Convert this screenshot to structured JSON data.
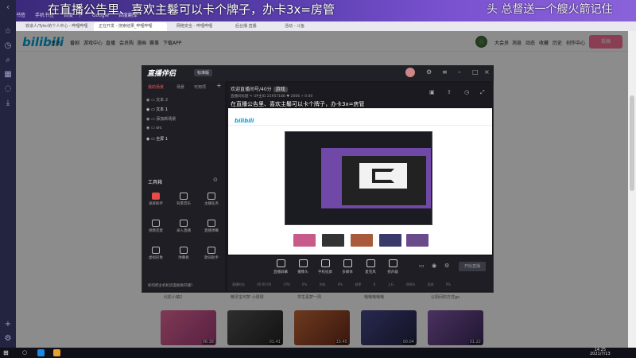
{
  "danmu": {
    "line1": "在直播公告里、喜欢主鬈可以卡个牌子，办卡3x=房管",
    "line2": "头 总督送一个艘火箭记住"
  },
  "browser": {
    "bookmarks": [
      "书签",
      "手机书签",
      "百度一下",
      "Google",
      "百度翻译"
    ],
    "tabs": [
      {
        "label": "铁道人/Tyler的个人中心 - 哔哩哔哩",
        "active": false
      },
      {
        "label": "正在开发 - 搜索结果_哔哩哔哩",
        "active": true
      },
      {
        "label": "网络安全 - 哔哩哔哩",
        "active": false
      },
      {
        "label": "后台播 直播",
        "active": false
      },
      {
        "label": "活动 - 斗鱼",
        "active": false
      }
    ]
  },
  "bilibili": {
    "logo": "bilibili",
    "nav": [
      "主站",
      "番剧",
      "游戏中心",
      "直播",
      "会员购",
      "漫画",
      "赛事",
      "下载APP"
    ],
    "right_nav": [
      "大会员",
      "消息",
      "动态",
      "收藏",
      "历史",
      "创作中心"
    ],
    "login_label": "投稿",
    "videos": [
      {
        "title": "北影小镇2",
        "duration": "06:38",
        "color": "#d24a7a"
      },
      {
        "title": "精灵宝可梦 小球球",
        "duration": "01:41",
        "color": "#444"
      },
      {
        "title": "学生恶梦一周",
        "duration": "15:45",
        "color": "#a84a2a"
      },
      {
        "title": "哦哦哦哦哦",
        "duration": "00:04",
        "color": "#3a3a70"
      },
      {
        "title": "以阳间的方式go",
        "duration": "01:22",
        "color": "#6a4a8a"
      }
    ]
  },
  "app": {
    "title": "直播伴侣",
    "version": "标准版",
    "left_tabs": [
      "我的场景",
      "场景",
      "可用项"
    ],
    "scenes": [
      "文本 2",
      "文本 1",
      "添加新场景",
      "src",
      "全屏 1"
    ],
    "tools_title": "工具箱",
    "tools": [
      {
        "label": "录屏助手",
        "highlight": true
      },
      {
        "label": "背景音乐",
        "highlight": false
      },
      {
        "label": "主播任务",
        "highlight": false
      },
      {
        "label": "视频连麦",
        "highlight": false
      },
      {
        "label": "录入直播",
        "highlight": false
      },
      {
        "label": "直播弹幕",
        "highlight": false
      },
      {
        "label": "虚拟形象",
        "highlight": false
      },
      {
        "label": "弹幕板",
        "highlight": false
      },
      {
        "label": "歌词助手",
        "highlight": false
      }
    ],
    "tip": "如何把主机机房面板换开播？",
    "room_title": "欢迎直播间号/40分",
    "room_tag": "游戏",
    "room_meta": [
      "直播间标题",
      "UP主ID 25957188",
      "2006",
      "0.00"
    ],
    "preview_banner": "在直播公告里、喜欢主鬈可以卡个牌子，办卡3x=房管",
    "bottom_tools": [
      "直播屏幕",
      "摄像头",
      "手机投屏",
      "多媒体",
      "麦克风",
      "扬声器"
    ],
    "live_button": "开始直播",
    "stats": [
      "直播时长 00:00:00",
      "CPU 0%",
      "内存 0%",
      "帧率 0",
      "上行 0KB/s",
      "丢帧 0%"
    ]
  },
  "taskbar": {
    "time": "14:25",
    "date": "2021/7/13"
  }
}
